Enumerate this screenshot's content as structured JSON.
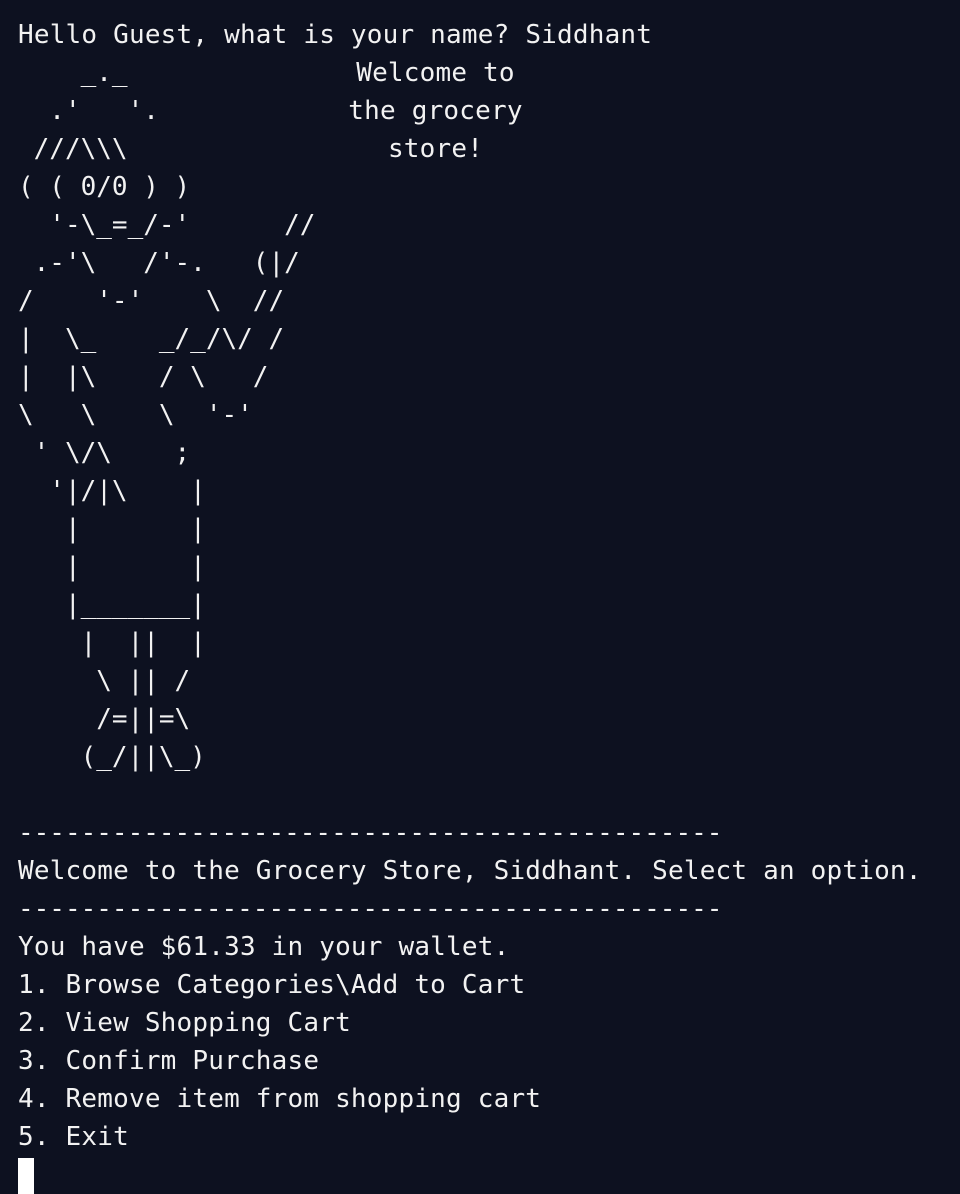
{
  "prompt": {
    "question": "Hello Guest, what is your name?",
    "answer": "Siddhant"
  },
  "ascii_art": [
    "    _._",
    "  .'   '.",
    " ///\\\\\\",
    "( ( 0/0 ) )",
    "  '-\\_=_/-'      //",
    " .-'\\   /'-.   (|/",
    "/    '-'    \\  //",
    "|  \\_    _/_/\\/ /",
    "|  |\\    / \\   /",
    "\\   \\    \\  '-'",
    " ' \\/\\    ;",
    "  '|/|\\    |",
    "   |       |",
    "   |       |",
    "   |_______|",
    "    |  ||  |",
    "     \\ || /",
    "     /=||=\\",
    "    (_/||\\_)"
  ],
  "greeting": [
    "Welcome to",
    "the grocery",
    "store!"
  ],
  "separator": "---------------------------------------------",
  "welcome_message": "Welcome to the Grocery Store, Siddhant. Select an option.",
  "wallet_line": "You have $61.33 in your wallet.",
  "menu": [
    "1. Browse Categories\\Add to Cart",
    "2. View Shopping Cart",
    "3. Confirm Purchase",
    "4. Remove item from shopping cart",
    "5. Exit"
  ],
  "colors": {
    "background": "#0d1120",
    "foreground": "#f2f2f2",
    "cursor": "#ffffff"
  }
}
